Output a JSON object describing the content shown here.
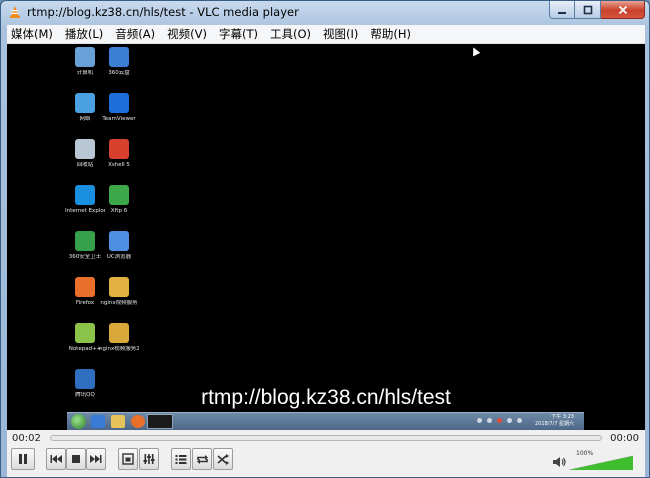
{
  "window": {
    "title": "rtmp://blog.kz38.cn/hls/test - VLC media player",
    "icon": "vlc-cone-icon"
  },
  "menu": [
    {
      "label": "媒体(M)"
    },
    {
      "label": "播放(L)"
    },
    {
      "label": "音频(A)"
    },
    {
      "label": "视频(V)"
    },
    {
      "label": "字幕(T)"
    },
    {
      "label": "工具(O)"
    },
    {
      "label": "视图(I)"
    },
    {
      "label": "帮助(H)"
    }
  ],
  "video": {
    "overlay_url": "rtmp://blog.kz38.cn/hls/test",
    "desktop_icons": [
      {
        "label": "计算机",
        "color": "#6aa0d8",
        "icon": "computer-icon"
      },
      {
        "label": "360云盘",
        "color": "#3b7fd4",
        "icon": "cloud-drive-icon"
      },
      {
        "label": "网络",
        "color": "#4aa0e0",
        "icon": "network-icon"
      },
      {
        "label": "TeamViewer",
        "color": "#1e6fd9",
        "icon": "teamviewer-icon"
      },
      {
        "label": "回收站",
        "color": "#b9c6d4",
        "icon": "recycle-bin-icon"
      },
      {
        "label": "Xshell 5",
        "color": "#d8402e",
        "icon": "xshell-icon"
      },
      {
        "label": "Internet Explorer",
        "color": "#1a8fe0",
        "icon": "ie-icon"
      },
      {
        "label": "Xftp 6",
        "color": "#3da84a",
        "icon": "xftp-icon"
      },
      {
        "label": "360安全卫士",
        "color": "#37a04a",
        "icon": "security-icon"
      },
      {
        "label": "UC浏览器",
        "color": "#4d8fe0",
        "icon": "uc-browser-icon"
      },
      {
        "label": "Firefox",
        "color": "#e8702a",
        "icon": "firefox-icon"
      },
      {
        "label": "nginx视频服务",
        "color": "#e0b040",
        "icon": "folder-icon"
      },
      {
        "label": "Notepad++",
        "color": "#8bc34a",
        "icon": "notepad-icon"
      },
      {
        "label": "nginx视频服务2",
        "color": "#d9a83a",
        "icon": "archive-icon"
      },
      {
        "label": "腾讯QQ",
        "color": "#2f6fc0",
        "icon": "app-icon"
      }
    ],
    "taskbar": {
      "clock_time": "下午 3:23",
      "clock_date": "2018/7/7 星期六"
    }
  },
  "controls": {
    "elapsed": "00:02",
    "total": "00:00",
    "progress": 0.0,
    "volume_percent": "100%",
    "volume_level": 1.0,
    "buttons": [
      {
        "name": "pause-button",
        "icon": "pause-icon"
      },
      {
        "name": "previous-button",
        "icon": "skip-back-icon"
      },
      {
        "name": "stop-button",
        "icon": "stop-icon"
      },
      {
        "name": "next-button",
        "icon": "skip-forward-icon"
      },
      {
        "name": "fullscreen-button",
        "icon": "fullscreen-icon"
      },
      {
        "name": "extended-settings-button",
        "icon": "equalizer-icon"
      },
      {
        "name": "playlist-button",
        "icon": "playlist-icon"
      },
      {
        "name": "loop-button",
        "icon": "loop-icon"
      },
      {
        "name": "shuffle-button",
        "icon": "shuffle-icon"
      }
    ]
  }
}
